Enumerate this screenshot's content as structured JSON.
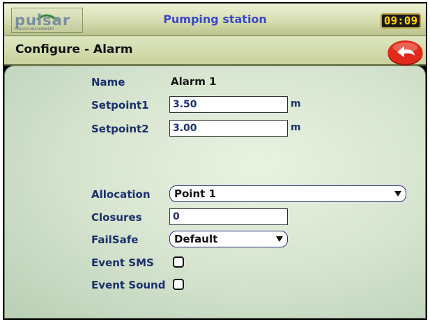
{
  "header": {
    "logo_text": "pulsar",
    "logo_subtext": "PROCESS MEASUREMENT",
    "title": "Pumping station",
    "clock": "09:09"
  },
  "page": {
    "title": "Configure - Alarm",
    "back_icon": "back-arrow-icon",
    "back_color": "#e02a1c"
  },
  "form": {
    "name_label": "Name",
    "name_value": "Alarm 1",
    "setpoint1_label": "Setpoint1",
    "setpoint1_value": "3.50",
    "setpoint1_unit": "m",
    "setpoint2_label": "Setpoint2",
    "setpoint2_value": "3.00",
    "setpoint2_unit": "m",
    "allocation_label": "Allocation",
    "allocation_value": "Point 1",
    "closures_label": "Closures",
    "closures_value": "0",
    "failsafe_label": "FailSafe",
    "failsafe_value": "Default",
    "event_sms_label": "Event SMS",
    "event_sms_checked": false,
    "event_sound_label": "Event Sound",
    "event_sound_checked": false
  },
  "colors": {
    "title_text": "#3a47c8",
    "label_text": "#1b2f6b",
    "clock_digits": "#ffd000"
  }
}
